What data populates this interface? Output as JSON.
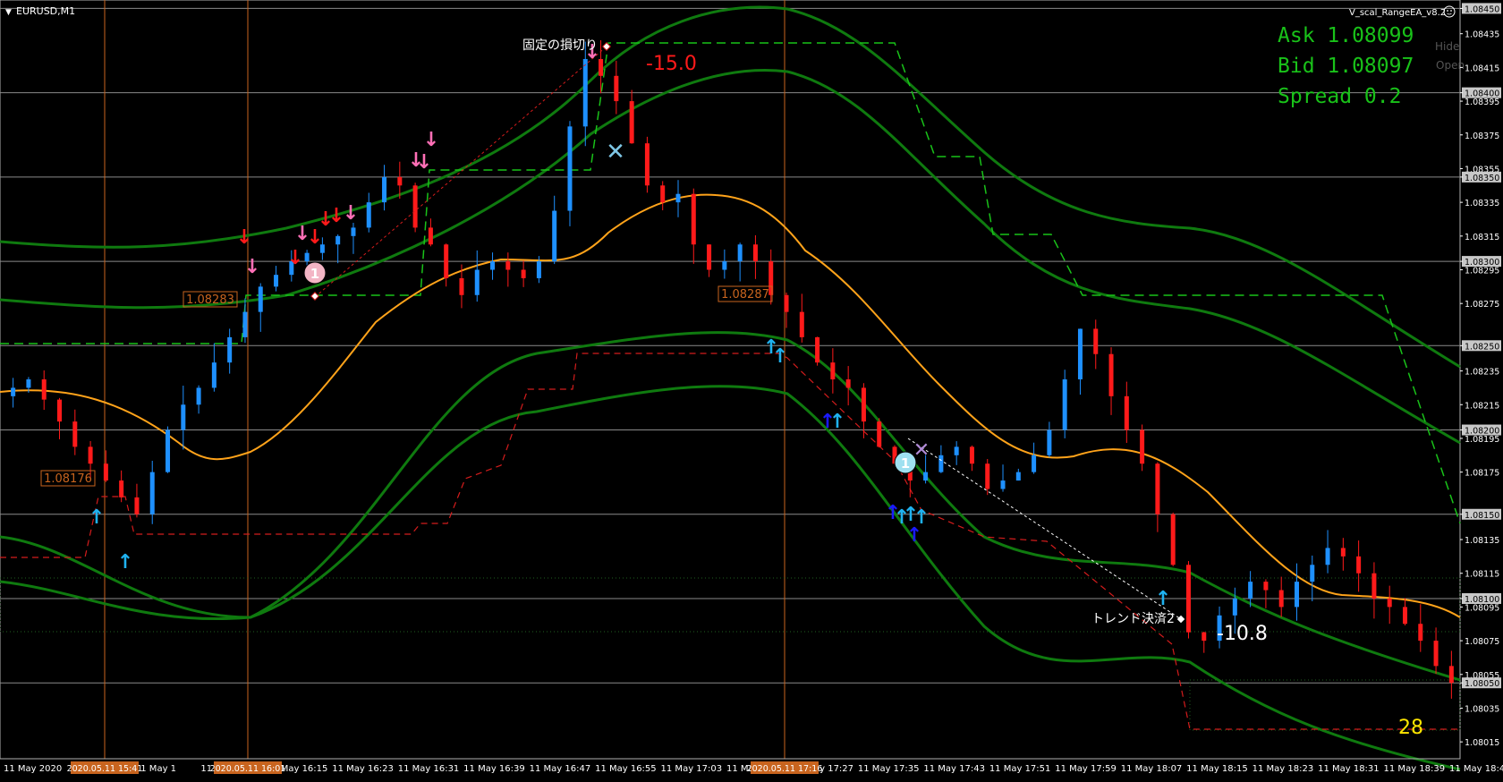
{
  "window": {
    "symbol_label": "EURUSD,M1",
    "ea_label": "V_scal_RangeEA_v8.2"
  },
  "quote": {
    "ask": "Ask 1.08099",
    "bid": "Bid 1.08097",
    "spread": "Spread 0.2",
    "hide": "Hide",
    "open": "Open"
  },
  "annotations": {
    "loss_fixed_text": "固定の損切り",
    "loss_fixed_value": "-15.0",
    "trend_exit_text": "トレンド決済2",
    "trend_exit_value": "-10.8",
    "counter": "28",
    "level_tags": [
      "1.08283",
      "1.08287",
      "1.08176"
    ],
    "order_badge": "1"
  },
  "chart_data": {
    "type": "candlestick",
    "symbol": "EURUSD",
    "timeframe": "M1",
    "ylim": [
      1.08005,
      1.08455
    ],
    "price_ticks": [
      "1.08450",
      "1.08435",
      "1.08415",
      "1.08400",
      "1.08395",
      "1.08375",
      "1.08355",
      "1.08350",
      "1.08335",
      "1.08315",
      "1.08300",
      "1.08295",
      "1.08275",
      "1.08250",
      "1.08235",
      "1.08215",
      "1.08200",
      "1.08195",
      "1.08175",
      "1.08150",
      "1.08135",
      "1.08115",
      "1.08100",
      "1.08095",
      "1.08075",
      "1.08055",
      "1.08050",
      "1.08035",
      "1.08015"
    ],
    "highlighted_ticks": [
      "1.08450",
      "1.08400",
      "1.08350",
      "1.08300",
      "1.08250",
      "1.08200",
      "1.08150",
      "1.08100",
      "1.08050"
    ],
    "time_labels": [
      "11 May 2020",
      "11 May 15:43",
      "11 May 1",
      "11 May 16:07",
      "11 May 16:15",
      "11 May 16:23",
      "11 May 16:31",
      "11 May 16:39",
      "11 May 16:47",
      "11 May 16:55",
      "11 May 17:03",
      "11 May 17:19",
      "11 May 17:27",
      "11 May 17:35",
      "11 May 17:43",
      "11 May 17:51",
      "11 May 17:59",
      "11 May 18:07",
      "11 May 18:15",
      "11 May 18:23",
      "11 May 18:31",
      "11 May 18:39",
      "11 May 18:47"
    ],
    "time_markers": [
      "2020.05.11 15:41",
      "2020.05.11 16:01",
      "2020.05.11 17:16"
    ],
    "close_path": [
      1.08225,
      1.0823,
      1.08218,
      1.08205,
      1.0819,
      1.0818,
      1.0817,
      1.0816,
      1.0815,
      1.08175,
      1.082,
      1.08215,
      1.08225,
      1.0824,
      1.08255,
      1.0827,
      1.08285,
      1.08292,
      1.083,
      1.08305,
      1.0831,
      1.08315,
      1.0832,
      1.08335,
      1.0835,
      1.08345,
      1.0832,
      1.0831,
      1.0829,
      1.0828,
      1.08295,
      1.083,
      1.08295,
      1.0829,
      1.083,
      1.0833,
      1.0838,
      1.0842,
      1.0841,
      1.08395,
      1.0837,
      1.08345,
      1.08335,
      1.0834,
      1.0831,
      1.08295,
      1.083,
      1.0831,
      1.083,
      1.0828,
      1.0827,
      1.08255,
      1.0824,
      1.0823,
      1.08225,
      1.08205,
      1.0819,
      1.0818,
      1.0817,
      1.08175,
      1.08185,
      1.0819,
      1.0818,
      1.08165,
      1.0817,
      1.08175,
      1.08185,
      1.082,
      1.0823,
      1.0826,
      1.08245,
      1.0822,
      1.082,
      1.0818,
      1.0815,
      1.0812,
      1.0808,
      1.08075,
      1.0809,
      1.081,
      1.0811,
      1.08105,
      1.08095,
      1.0811,
      1.0812,
      1.0813,
      1.08125,
      1.08115,
      1.081,
      1.08095,
      1.08085,
      1.08075,
      1.0806,
      1.0805
    ]
  }
}
